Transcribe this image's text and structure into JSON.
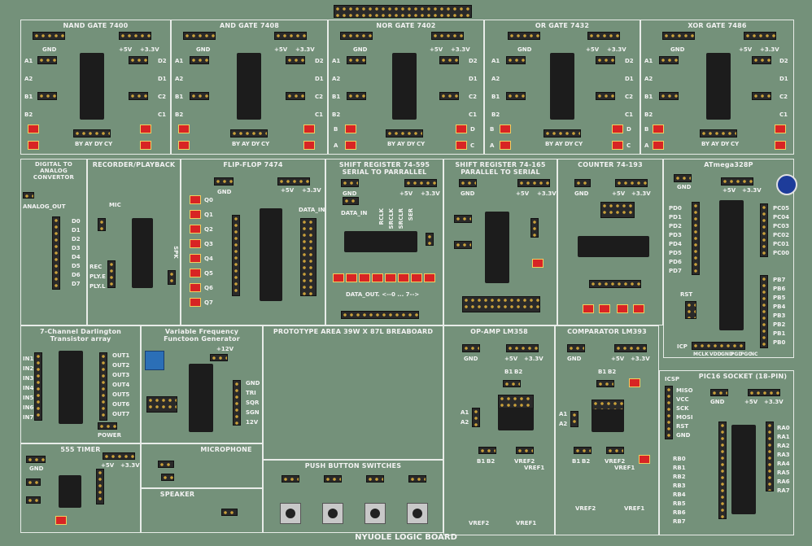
{
  "board": {
    "title": "NYUOLE LOGIC BOARD"
  },
  "sections": [
    {
      "id": "nand",
      "title": "NAND GATE 7400"
    },
    {
      "id": "and",
      "title": "AND GATE 7408"
    },
    {
      "id": "nor",
      "title": "NOR GATE 7402"
    },
    {
      "id": "or",
      "title": "OR GATE 7432"
    },
    {
      "id": "xor",
      "title": "XOR GATE 7486"
    },
    {
      "id": "dac",
      "title": "DIGITAL TO ANALOG CONVERTOR"
    },
    {
      "id": "rec",
      "title": "RECORDER/PLAYBACK"
    },
    {
      "id": "ff",
      "title": "FLIP-FLOP 7474"
    },
    {
      "id": "sipo",
      "title": "SHIFT REGISTER 74-595 SERIAL TO PARRALLEL"
    },
    {
      "id": "piso",
      "title": "SHIFT REGISTER 74-165 PARALLEL TO SERIAL"
    },
    {
      "id": "counter",
      "title": "COUNTER 74-193"
    },
    {
      "id": "atmega",
      "title": "ATmega328P"
    },
    {
      "id": "darl",
      "title": "7-Channel Darlington Transistor array"
    },
    {
      "id": "vfg",
      "title": "Variable Frequency Functoon Generator"
    },
    {
      "id": "proto",
      "title": "PROTOTYPE AREA 39W X 87L BREABOARD"
    },
    {
      "id": "opamp",
      "title": "OP-AMP LM358"
    },
    {
      "id": "comp",
      "title": "COMPARATOR LM393"
    },
    {
      "id": "pic",
      "title": "PIC16 SOCKET (18-PIN)"
    },
    {
      "id": "timer",
      "title": "555 TIMER"
    },
    {
      "id": "mic",
      "title": "MICROPHONE"
    },
    {
      "id": "spk",
      "title": "SPEAKER"
    },
    {
      "id": "pbs",
      "title": "PUSH BUTTON SWITCHES"
    }
  ],
  "labels": {
    "gnd": "GND",
    "p5": "+5V",
    "p33": "+3.3V",
    "p12": "+12V",
    "gate_left": [
      "A1",
      "A2",
      "B1",
      "B2"
    ],
    "gate_right": [
      "D2",
      "D1",
      "C2",
      "C1"
    ],
    "gate_bottom": [
      "BY",
      "AY",
      "DY",
      "CY"
    ],
    "gate_b": "B",
    "gate_a": "A",
    "gate_d": "D",
    "gate_c": "C",
    "dac_out": "ANALOG_OUT",
    "dac_pins": [
      "D0",
      "D1",
      "D2",
      "D3",
      "D4",
      "D5",
      "D6",
      "D7"
    ],
    "rec_pins": [
      "REC",
      "PLY.E",
      "PLY.L"
    ],
    "rec_mic": "MIC",
    "rec_spk": "SPK",
    "ff_q": [
      "Q0",
      "Q1",
      "Q2",
      "Q3",
      "Q4",
      "Q5",
      "Q6",
      "Q7"
    ],
    "ff_data": "DATA_IN",
    "sipo_data_in": "DATA_IN",
    "sipo_ctrl": [
      "RCLK",
      "SRCLK",
      "SRCLR",
      "SER"
    ],
    "sipo_data_out": "DATA_OUT. <--0 ... 7-->",
    "atmega_left": [
      "PD0",
      "PD1",
      "PD2",
      "PD3",
      "PD4",
      "PD5",
      "PD6",
      "PD7"
    ],
    "atmega_right": [
      "PC05",
      "PC04",
      "PC03",
      "PC02",
      "PC01",
      "PC00"
    ],
    "atmega_rst": "RST",
    "atmega_bottom": [
      "MCLK",
      "VDD",
      "GND",
      "PGD",
      "PGC",
      "NC"
    ],
    "atmega_pb": [
      "PB7",
      "PB6",
      "PB5",
      "PB4",
      "PB3",
      "PB2",
      "PB1",
      "PB0"
    ],
    "atmega_icp": "ICP",
    "darl_in": [
      "IN1",
      "IN2",
      "IN3",
      "IN4",
      "IN5",
      "IN6",
      "IN7"
    ],
    "darl_out": [
      "OUT1",
      "OUT2",
      "OUT3",
      "OUT4",
      "OUT5",
      "OUT6",
      "OUT7"
    ],
    "darl_power": "POWER",
    "vfg_out": [
      "GND",
      "TRI",
      "SQR",
      "SGN",
      "12V"
    ],
    "op_b": [
      "B1",
      "B2"
    ],
    "op_a": [
      "A1",
      "A2"
    ],
    "op_vref": [
      "VREF2",
      "VREF1"
    ],
    "icsp": "ICSP",
    "icsp_pins": [
      "MISO",
      "VCC",
      "SCK",
      "MOSI",
      "RST",
      "GND"
    ],
    "pic_rb": [
      "RB0",
      "RB1",
      "RB2",
      "RB3",
      "RB4",
      "RB5",
      "RB6",
      "RB7"
    ],
    "pic_ra": [
      "RA0",
      "RA1",
      "RA2",
      "RA3",
      "RA4",
      "RA5",
      "RA6",
      "RA7"
    ],
    "timer_pins": [
      "GND",
      "+5V",
      "+3.3V"
    ]
  },
  "colors": {
    "pcb": "#74917a",
    "silk": "#f2f2f2",
    "chip": "#1c1c1c",
    "led": "#d82424",
    "header": "#2a2a2a",
    "pot": "#2b6fb7"
  }
}
